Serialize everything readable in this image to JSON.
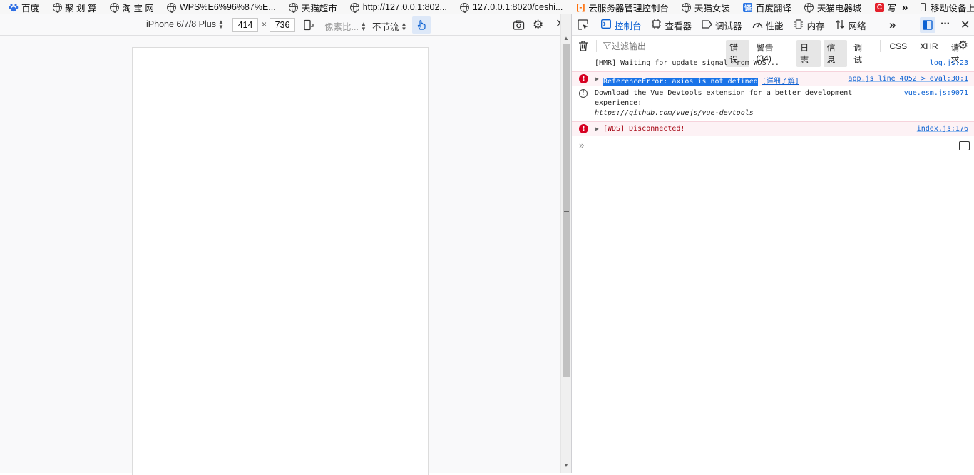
{
  "bookmarks": [
    {
      "label": "百度",
      "icon": "baidu-paw-icon"
    },
    {
      "label": "聚 划 算",
      "icon": "globe-icon"
    },
    {
      "label": "淘 宝 网",
      "icon": "globe-icon"
    },
    {
      "label": "WPS%E6%96%87%E...",
      "icon": "globe-icon"
    },
    {
      "label": "天猫超市",
      "icon": "globe-icon"
    },
    {
      "label": "http://127.0.0.1:802...",
      "icon": "globe-icon"
    },
    {
      "label": "127.0.0.1:8020/ceshi...",
      "icon": "globe-icon"
    },
    {
      "label": "云服务器管理控制台",
      "icon": "aliyun-icon"
    },
    {
      "label": "天猫女装",
      "icon": "globe-icon"
    },
    {
      "label": "百度翻译",
      "icon": "translate-icon"
    },
    {
      "label": "天猫电器城",
      "icon": "globe-icon"
    },
    {
      "label": "写",
      "icon": "csdn-icon"
    }
  ],
  "bookmarks_overflow": "»",
  "mobile_bookmarks": "移动设备上的书签",
  "rdm": {
    "device": "iPhone 6/7/8 Plus",
    "width": "414",
    "times": "×",
    "height": "736",
    "pixel_ratio": "像素比...",
    "throttle": "不节流"
  },
  "devtools": {
    "tabs": [
      {
        "label": "控制台",
        "icon": "console-icon",
        "active": true
      },
      {
        "label": "查看器",
        "icon": "inspector-icon",
        "active": false
      },
      {
        "label": "调试器",
        "icon": "debugger-icon",
        "active": false
      },
      {
        "label": "性能",
        "icon": "performance-icon",
        "active": false
      },
      {
        "label": "内存",
        "icon": "memory-icon",
        "active": false
      },
      {
        "label": "网络",
        "icon": "network-icon",
        "active": false
      }
    ],
    "filter_placeholder": "过滤输出",
    "filters": [
      {
        "label": "错误",
        "on": true
      },
      {
        "label": "警告 (34)",
        "on": false
      },
      {
        "label": "日志",
        "on": true
      },
      {
        "label": "信息",
        "on": true
      },
      {
        "label": "调试",
        "on": false
      },
      {
        "label": "CSS",
        "on": false
      },
      {
        "label": "XHR",
        "on": false
      },
      {
        "label": "请求",
        "on": false
      }
    ],
    "messages": {
      "m1": {
        "text": "[HMR] Waiting for update signal from WDS...",
        "loc": "log.js:23"
      },
      "m2": {
        "text": "ReferenceError: axios is not defined",
        "more": "[详细了解]",
        "loc": "app.js line 4052 > eval:30:1"
      },
      "m3": {
        "line1": "Download the Vue Devtools extension for a better development",
        "line2": "experience:",
        "line3": "https://github.com/vuejs/vue-devtools",
        "loc": "vue.esm.js:9071"
      },
      "m4": {
        "text": "[WDS] Disconnected!",
        "loc": "index.js:176"
      }
    },
    "prompt": "»"
  },
  "colors": {
    "accent": "#0a60d2",
    "error": "#d70022",
    "error_bg": "#fdf2f5",
    "highlight": "#1a73e8"
  }
}
